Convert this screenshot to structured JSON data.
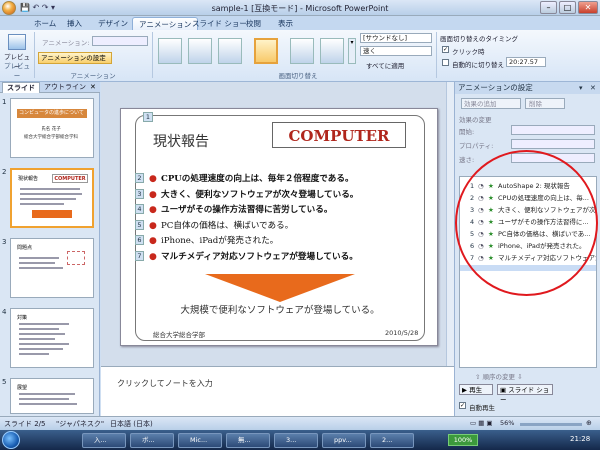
{
  "window": {
    "title": "sample-1 [互換モード] - Microsoft PowerPoint",
    "controls": {
      "min": "–",
      "max": "□",
      "close": "✕"
    }
  },
  "ribbon_tabs": [
    "ホーム",
    "挿入",
    "デザイン",
    "アニメーション",
    "スライド ショー",
    "校閲",
    "表示"
  ],
  "active_tab": "アニメーション",
  "ribbon": {
    "preview_group": {
      "button": "プレビュー",
      "label": "プレビュー"
    },
    "animation_group": {
      "animation_dropdown_label": "アニメーション:",
      "custom_animation_button": "アニメーションの設定",
      "label": "アニメーション"
    },
    "transition_group": {
      "sound": "[サウンドなし]",
      "speed": "速く",
      "apply_all": "すべてに適用",
      "label": "画面切り替え"
    },
    "timing_group": {
      "heading": "画面切り替えのタイミング",
      "on_click": "クリック時",
      "auto_after": "自動的に切り替え",
      "time": "20:27.57"
    }
  },
  "left_pane": {
    "tabs": [
      "スライド",
      "アウトライン"
    ],
    "thumbnails": [
      {
        "num": "1",
        "title": "コンピュータの進歩について",
        "sub1": "氏名 花子",
        "sub2": "総合大学総合学部総合学科"
      },
      {
        "num": "2",
        "title": "現状報告",
        "logo": "COMPUTER"
      },
      {
        "num": "3",
        "title": "問題点"
      },
      {
        "num": "4",
        "title": "対策"
      },
      {
        "num": "5",
        "title": "展望"
      }
    ]
  },
  "slide": {
    "badge_num": "1",
    "title": "現状報告",
    "logo_text": "COMPUTER",
    "bullets": [
      {
        "num": "2",
        "text": "CPUの処理速度の向上は、毎年２倍程度である。"
      },
      {
        "num": "3",
        "text": "大きく、便利なソフトウェアが次々登場している。"
      },
      {
        "num": "4",
        "text": "ユーザがその操作方法習得に苦労している。"
      },
      {
        "num": "5",
        "text": "PC自体の価格は、横ばいである。"
      },
      {
        "num": "6",
        "text": "iPhone、iPadが発売された。"
      },
      {
        "num": "7",
        "text": "マルチメディア対応ソフトウェアが登場している。"
      }
    ],
    "arrow_text": "大規模で便利なソフトウェアが登場している。",
    "footer_left": "総合大学総合学部",
    "footer_right": "2010/5/28"
  },
  "notes": {
    "placeholder": "クリックしてノートを入力"
  },
  "task_pane": {
    "title": "アニメーションの設定",
    "add_effect": "効果の追加",
    "remove": "削除",
    "change_label": "効果の変更",
    "start_label": "開始:",
    "property_label": "プロパティ:",
    "speed_label": "速さ:",
    "items": [
      {
        "num": "1",
        "text": "AutoShape 2: 現状報告"
      },
      {
        "num": "2",
        "text": "CPUの処理速度の向上は、毎..."
      },
      {
        "num": "3",
        "text": "大きく、便利なソフトウェアが次..."
      },
      {
        "num": "4",
        "text": "ユーザがその操作方法習得に..."
      },
      {
        "num": "5",
        "text": "PC自体の価格は、横ばいであ..."
      },
      {
        "num": "6",
        "text": "iPhone、iPadが発売された。"
      },
      {
        "num": "7",
        "text": "マルチメディア対応ソフトウェアが..."
      }
    ],
    "reorder": "順序の変更",
    "play": "再生",
    "slideshow": "スライド ショー",
    "auto_preview": "自動再生"
  },
  "status_bar": {
    "slide": "スライド 2/5",
    "theme": "\"ジャパネスク\"",
    "language": "日本語 (日本)",
    "zoom": "56%"
  },
  "taskbar": {
    "items": [
      "入...",
      "ボ...",
      "Mic...",
      "無...",
      "3...",
      "ppv...",
      "2..."
    ],
    "battery": "100%",
    "clock": "21:28"
  },
  "colors": {
    "accent": "#e6a23c",
    "logo_red": "#b0261c",
    "annotation_red": "#e0191e",
    "arrow": "#e86a1c"
  }
}
